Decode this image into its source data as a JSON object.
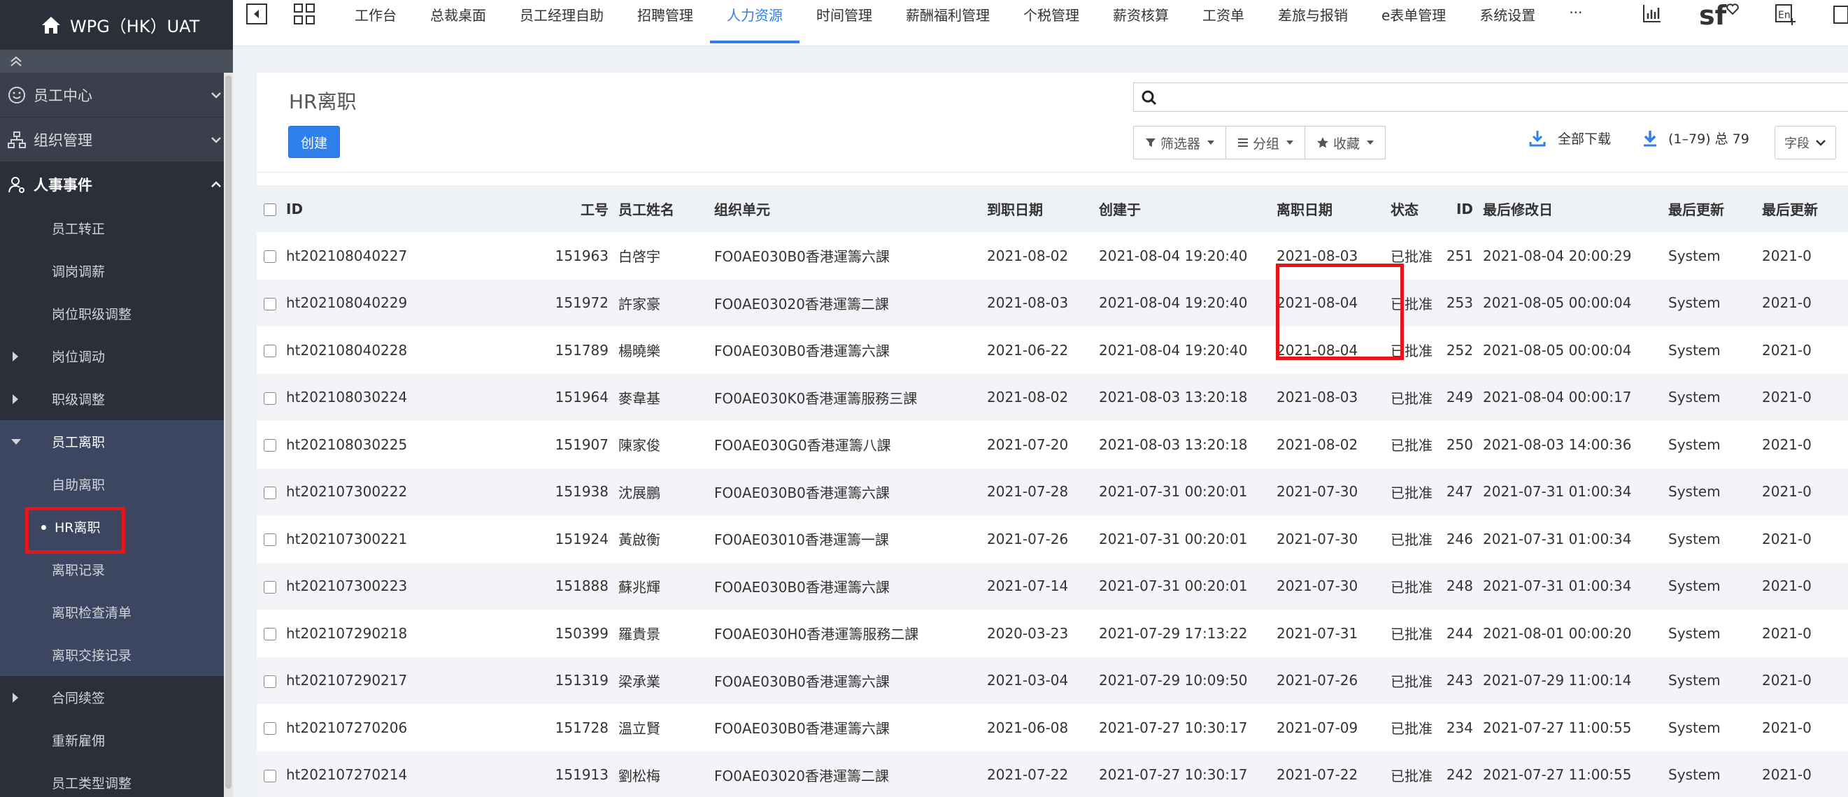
{
  "app": {
    "title": "WPG（HK）UAT"
  },
  "topnav": {
    "tabs": [
      {
        "label": "工作台"
      },
      {
        "label": "总裁桌面"
      },
      {
        "label": "员工经理自助"
      },
      {
        "label": "招聘管理"
      },
      {
        "label": "人力资源"
      },
      {
        "label": "时间管理"
      },
      {
        "label": "薪酬福利管理"
      },
      {
        "label": "个税管理"
      },
      {
        "label": "薪资核算"
      },
      {
        "label": "工资单"
      },
      {
        "label": "差旅与报销"
      },
      {
        "label": "e表单管理"
      },
      {
        "label": "系统设置"
      },
      {
        "label": "···"
      }
    ],
    "active_tab": "人力资源",
    "logo_text": "sf"
  },
  "sidebar": {
    "groups": [
      {
        "label": "员工中心",
        "icon": "smile-icon"
      },
      {
        "label": "组织管理",
        "icon": "org-chart-icon"
      },
      {
        "label": "人事事件",
        "icon": "user-gear-icon"
      }
    ],
    "items": [
      {
        "label": "员工转正"
      },
      {
        "label": "调岗调薪"
      },
      {
        "label": "岗位职级调整"
      },
      {
        "label": "岗位调动"
      },
      {
        "label": "职级调整"
      },
      {
        "label": "员工离职"
      },
      {
        "label": "自助离职"
      },
      {
        "label": "HR离职"
      },
      {
        "label": "离职记录"
      },
      {
        "label": "离职检查清单"
      },
      {
        "label": "离职交接记录"
      },
      {
        "label": "合同续签"
      },
      {
        "label": "重新雇佣"
      },
      {
        "label": "员工类型调整"
      }
    ]
  },
  "page": {
    "title": "HR离职",
    "create_label": "创建",
    "search_placeholder": "",
    "filter_label": "筛选器",
    "group_label": "分组",
    "favorite_label": "收藏",
    "download_all_label": "全部下载",
    "pager_label": "(1–79) 总 79",
    "fields_label": "字段"
  },
  "table": {
    "columns": [
      "ID",
      "工号",
      "员工姓名",
      "组织单元",
      "到职日期",
      "创建于",
      "离职日期",
      "状态",
      "ID",
      "最后修改日",
      "最后更新",
      "最后更新"
    ],
    "rows": [
      [
        "ht202108040227",
        "151963",
        "白啓宇",
        "FO0AE030B0香港運籌六課",
        "2021-08-02",
        "2021-08-04 19:20:40",
        "2021-08-03",
        "已批准",
        "251",
        "2021-08-04 20:00:29",
        "System",
        "2021-0"
      ],
      [
        "ht202108040229",
        "151972",
        "許家豪",
        "FO0AE03020香港運籌二課",
        "2021-08-03",
        "2021-08-04 19:20:40",
        "2021-08-04",
        "已批准",
        "253",
        "2021-08-05 00:00:04",
        "System",
        "2021-0"
      ],
      [
        "ht202108040228",
        "151789",
        "楊曉樂",
        "FO0AE030B0香港運籌六課",
        "2021-06-22",
        "2021-08-04 19:20:40",
        "2021-08-04",
        "已批准",
        "252",
        "2021-08-05 00:00:04",
        "System",
        "2021-0"
      ],
      [
        "ht202108030224",
        "151964",
        "麥韋基",
        "FO0AE030K0香港運籌服務三課",
        "2021-08-02",
        "2021-08-03 13:20:18",
        "2021-08-03",
        "已批准",
        "249",
        "2021-08-04 00:00:17",
        "System",
        "2021-0"
      ],
      [
        "ht202108030225",
        "151907",
        "陳家俊",
        "FO0AE030G0香港運籌八課",
        "2021-07-20",
        "2021-08-03 13:20:18",
        "2021-08-02",
        "已批准",
        "250",
        "2021-08-03 14:00:36",
        "System",
        "2021-0"
      ],
      [
        "ht202107300222",
        "151938",
        "沈展鵬",
        "FO0AE030B0香港運籌六課",
        "2021-07-28",
        "2021-07-31 00:20:01",
        "2021-07-30",
        "已批准",
        "247",
        "2021-07-31 01:00:34",
        "System",
        "2021-0"
      ],
      [
        "ht202107300221",
        "151924",
        "黃啟衡",
        "FO0AE03010香港運籌一課",
        "2021-07-26",
        "2021-07-31 00:20:01",
        "2021-07-30",
        "已批准",
        "246",
        "2021-07-31 01:00:34",
        "System",
        "2021-0"
      ],
      [
        "ht202107300223",
        "151888",
        "蘇兆輝",
        "FO0AE030B0香港運籌六課",
        "2021-07-14",
        "2021-07-31 00:20:01",
        "2021-07-30",
        "已批准",
        "248",
        "2021-07-31 01:00:34",
        "System",
        "2021-0"
      ],
      [
        "ht202107290218",
        "150399",
        "羅貴景",
        "FO0AE030H0香港運籌服務二課",
        "2020-03-23",
        "2021-07-29 17:13:22",
        "2021-07-31",
        "已批准",
        "244",
        "2021-08-01 00:00:20",
        "System",
        "2021-0"
      ],
      [
        "ht202107290217",
        "151319",
        "梁承業",
        "FO0AE030B0香港運籌六課",
        "2021-03-04",
        "2021-07-29 10:09:50",
        "2021-07-26",
        "已批准",
        "243",
        "2021-07-29 11:00:14",
        "System",
        "2021-0"
      ],
      [
        "ht202107270206",
        "151728",
        "溫立賢",
        "FO0AE030B0香港運籌六課",
        "2021-06-08",
        "2021-07-27 10:30:17",
        "2021-07-09",
        "已批准",
        "234",
        "2021-07-27 11:00:55",
        "System",
        "2021-0"
      ],
      [
        "ht202107270214",
        "151913",
        "劉松梅",
        "FO0AE03020香港運籌二課",
        "2021-07-22",
        "2021-07-27 10:30:17",
        "2021-07-22",
        "已批准",
        "242",
        "2021-07-27 11:00:55",
        "System",
        "2021-0"
      ]
    ]
  },
  "colors": {
    "accent": "#2f80ed",
    "sidebar_bg": "#2b2f3a",
    "highlight": "#e4161b"
  }
}
